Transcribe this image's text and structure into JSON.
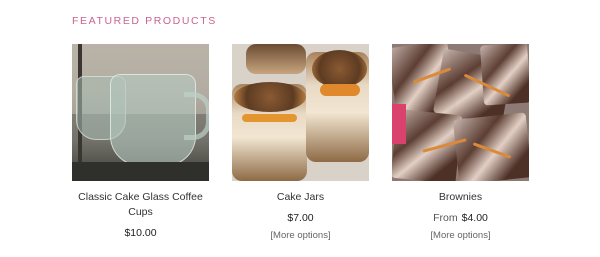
{
  "section": {
    "title": "FEATURED PRODUCTS"
  },
  "products": [
    {
      "name": "Classic Cake Glass Coffee Cups",
      "price": "$10.00",
      "from_label": "",
      "more_options": "",
      "image_icon": "glass-mugs-photo"
    },
    {
      "name": "Cake Jars",
      "price": "$7.00",
      "from_label": "",
      "more_options": "[More options]",
      "image_icon": "cake-jars-photo"
    },
    {
      "name": "Brownies",
      "price": "$4.00",
      "from_label": "From",
      "more_options": "[More options]",
      "image_icon": "brownies-photo"
    }
  ],
  "colors": {
    "title_accent": "#c9648f"
  }
}
